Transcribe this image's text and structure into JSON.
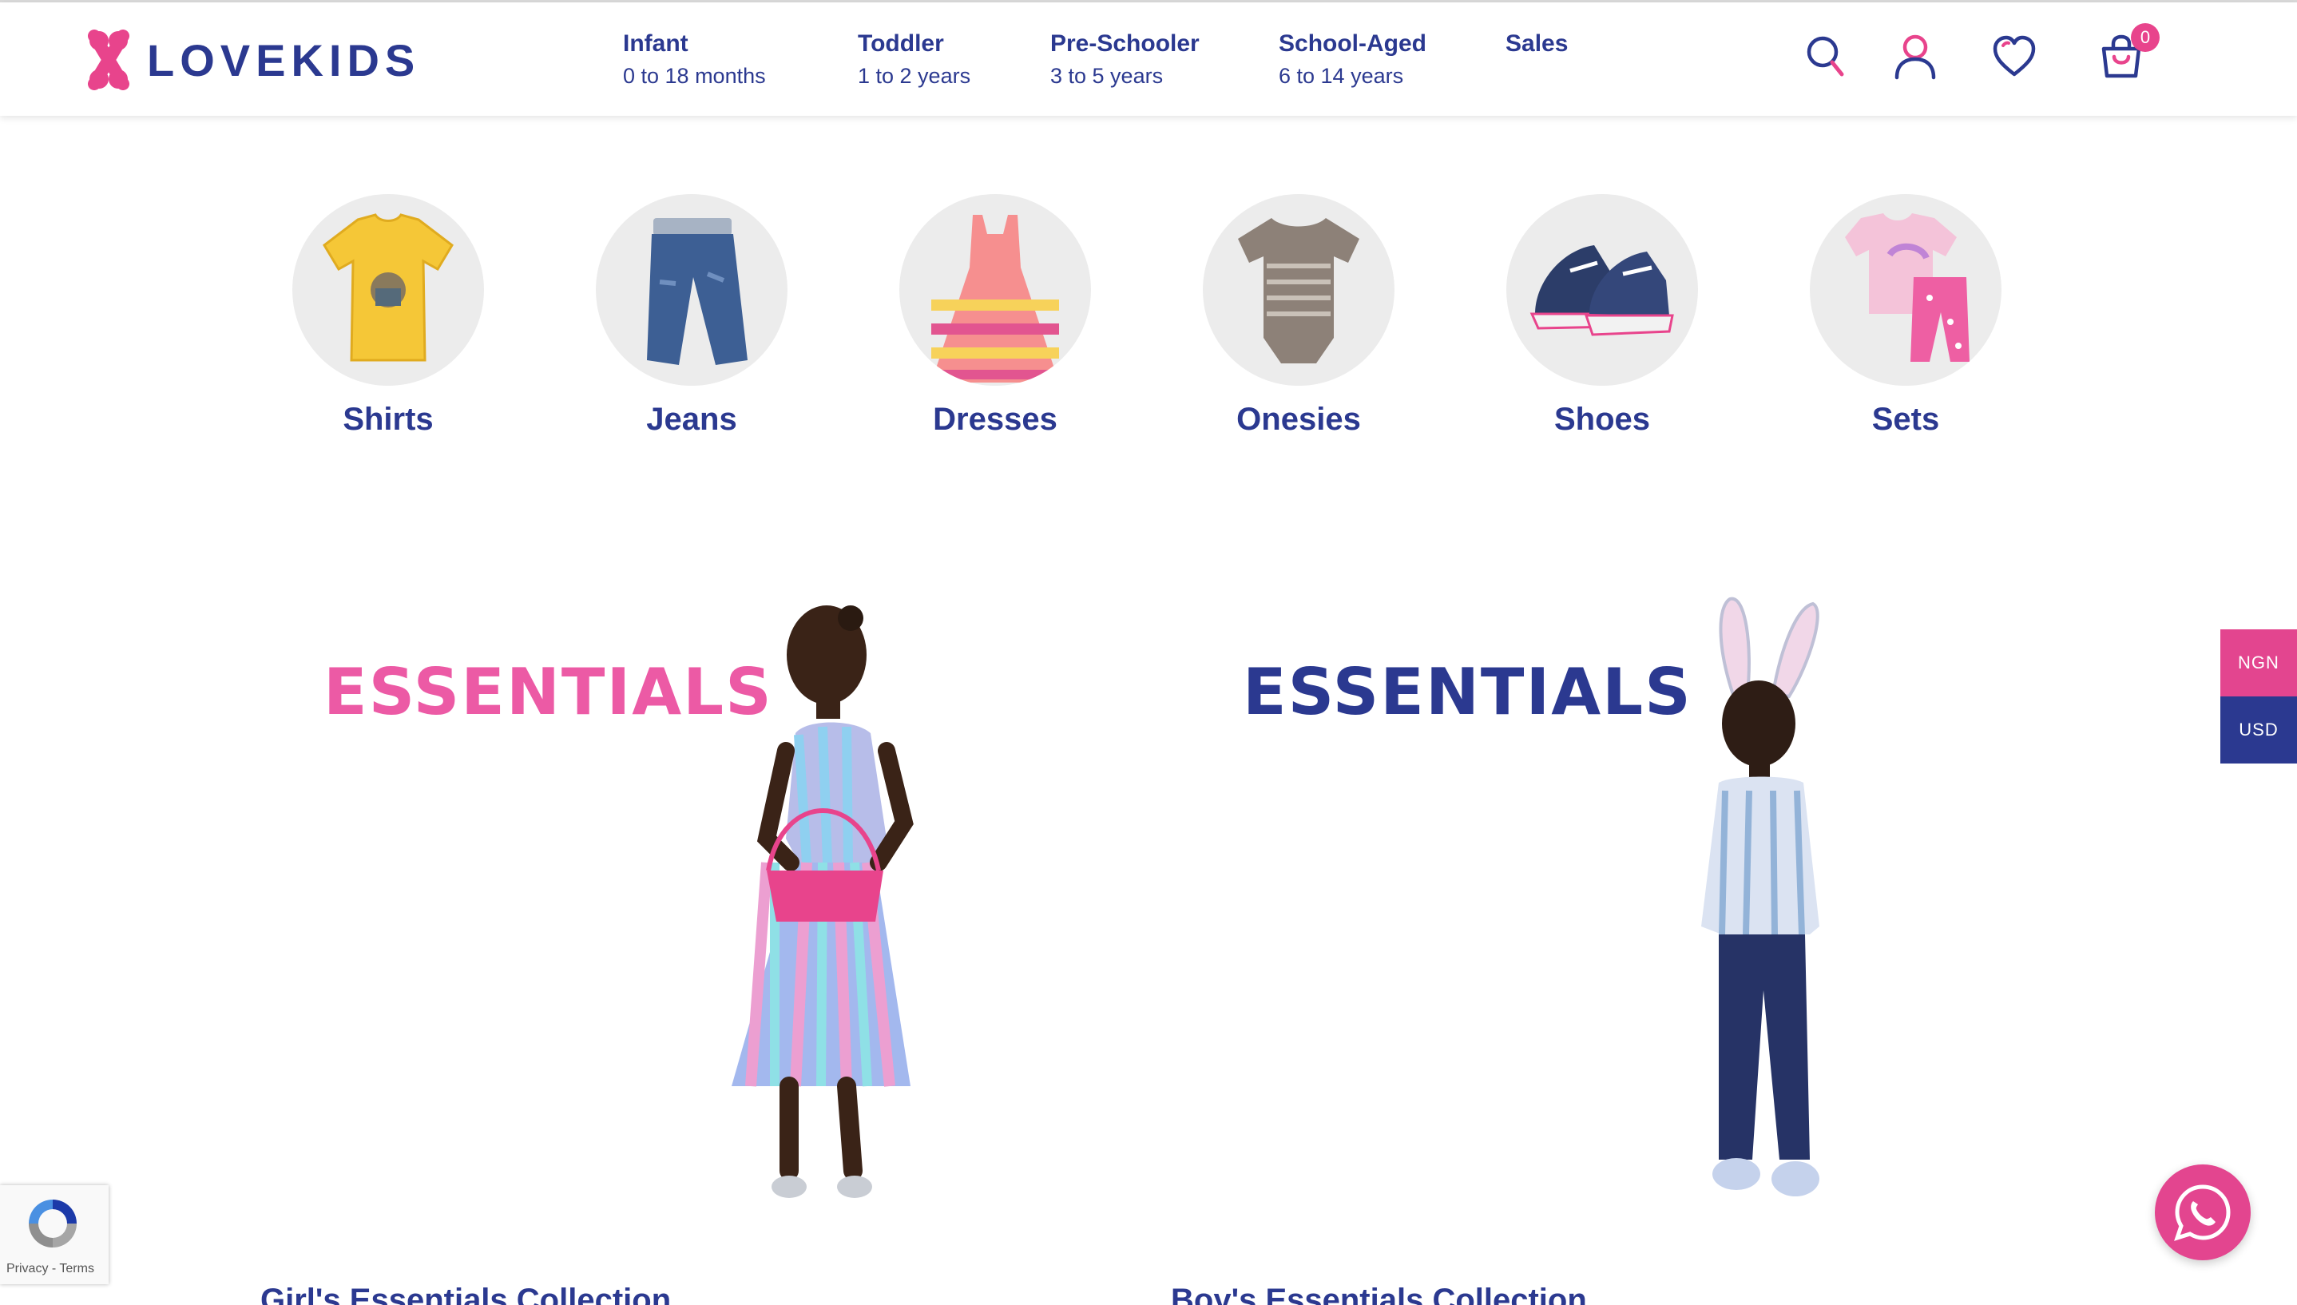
{
  "brand": {
    "name": "LOVEKIDS",
    "primary": "#2b3990",
    "accent": "#e8448c"
  },
  "nav": [
    {
      "title": "Infant",
      "sub": "0 to 18 months"
    },
    {
      "title": "Toddler",
      "sub": "1 to 2 years"
    },
    {
      "title": "Pre-Schooler",
      "sub": "3 to 5 years"
    },
    {
      "title": "School-Aged",
      "sub": "6 to 14 years"
    },
    {
      "title": "Sales",
      "sub": ""
    }
  ],
  "header_icons": [
    "search-icon",
    "user-icon",
    "heart-icon",
    "cart-icon"
  ],
  "cart": {
    "count": "0"
  },
  "categories": [
    "Shirts",
    "Jeans",
    "Dresses",
    "Onesies",
    "Shoes",
    "Sets"
  ],
  "banners": {
    "girls": {
      "title": "ESSENTIALS",
      "caption": "Girl's Essentials Collection"
    },
    "boys": {
      "title": "ESSENTIALS",
      "caption": "Boy's Essentials Collection"
    }
  },
  "currency": {
    "ngn": "NGN",
    "usd": "USD"
  },
  "recaptcha": {
    "privacy": "Privacy",
    "separator": " - ",
    "terms": "Terms"
  },
  "floating": {
    "icon": "whatsapp-icon"
  }
}
